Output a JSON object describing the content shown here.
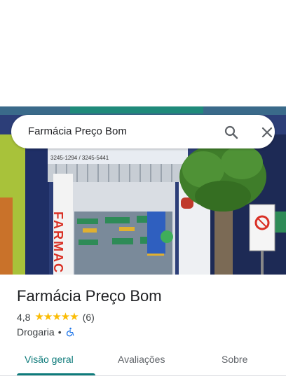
{
  "search": {
    "query": "Farmácia Preço Bom"
  },
  "photo": {
    "phone_numbers": "3245-1294 / 3245-5441",
    "sign_text": "FARMAC",
    "colors": {
      "facade_blue": "#2c3e78",
      "sign_red": "#d93025",
      "tree_green": "#3f7d2a",
      "shelf_green": "#2e8b57"
    }
  },
  "place": {
    "name": "Farmácia Preço Bom",
    "rating": "4,8",
    "stars": "★★★★★",
    "review_count": "(6)",
    "category": "Drogaria",
    "separator": "•",
    "accessibility_icon": "wheelchair-icon"
  },
  "tabs": [
    {
      "label": "Visão geral",
      "active": true
    },
    {
      "label": "Avaliações",
      "active": false
    },
    {
      "label": "Sobre",
      "active": false
    }
  ],
  "colors": {
    "accent": "#0e7b7b",
    "star": "#fbbc04",
    "text_primary": "#202124",
    "text_secondary": "#3c4043"
  },
  "icons": {
    "search": "search-icon",
    "close": "close-icon"
  }
}
